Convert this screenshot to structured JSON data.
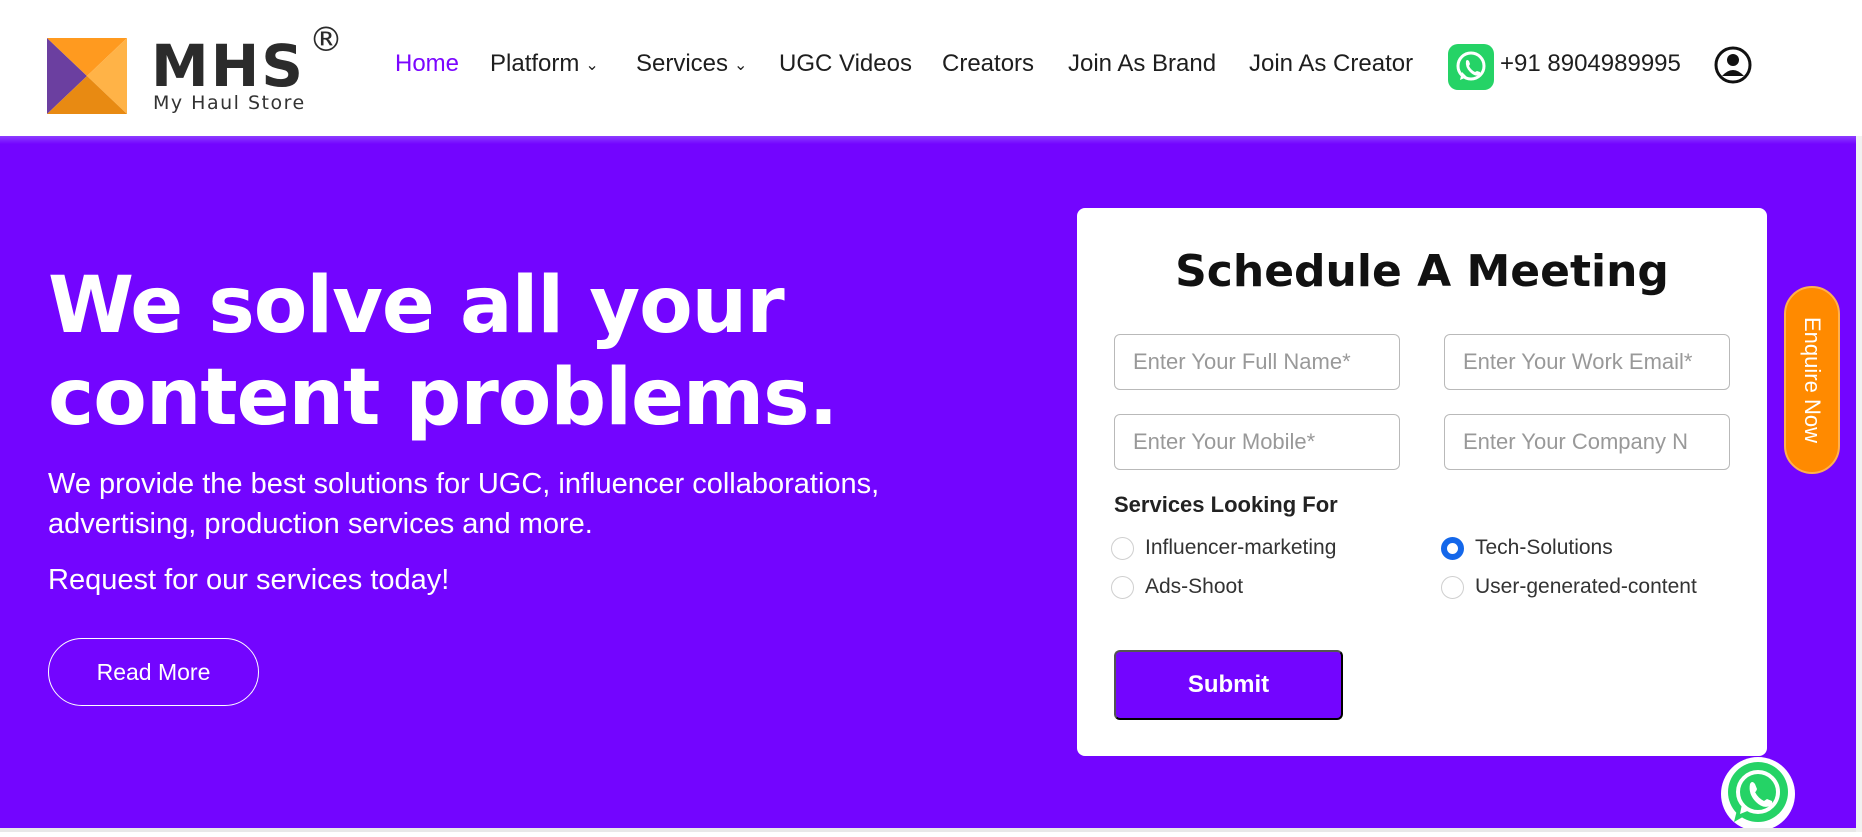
{
  "brand": {
    "name": "MHS",
    "registered": "®",
    "tagline": "My Haul Store",
    "colors": {
      "orange": "#ff9a1f",
      "purple": "#6b3fa0"
    }
  },
  "nav": {
    "items": [
      {
        "label": "Home",
        "active": true
      },
      {
        "label": "Platform",
        "dropdown": true
      },
      {
        "label": "Services",
        "dropdown": true
      },
      {
        "label": "UGC Videos"
      },
      {
        "label": "Creators"
      },
      {
        "label": "Join As Brand"
      },
      {
        "label": "Join As Creator"
      }
    ],
    "chevron": "⌄",
    "phone": "+91 8904989995",
    "whatsapp_icon": "whatsapp-icon",
    "account_icon": "user-circle-icon"
  },
  "hero": {
    "headline_line1": "We solve all your",
    "headline_line2": "content problems.",
    "subtext": "We provide the best solutions for UGC, influencer collaborations, advertising, production services and more.",
    "request_text": "Request for our services today!",
    "cta": "Read More",
    "background": "#7305ff"
  },
  "form": {
    "title": "Schedule A Meeting",
    "fields": {
      "full_name": "Enter Your Full Name*",
      "work_email": "Enter Your Work Email*",
      "mobile": "Enter Your Mobile*",
      "company": "Enter Your Company N"
    },
    "services_label": "Services Looking For",
    "services": [
      {
        "label": "Influencer-marketing",
        "selected": false
      },
      {
        "label": "Tech-Solutions",
        "selected": true
      },
      {
        "label": "Ads-Shoot",
        "selected": false
      },
      {
        "label": "User-generated-content",
        "selected": false
      }
    ],
    "submit": "Submit"
  },
  "side_tab": {
    "label": "Enquire Now",
    "color": "#ff8a00"
  },
  "floating": {
    "icon": "whatsapp-icon",
    "color": "#25d366"
  }
}
